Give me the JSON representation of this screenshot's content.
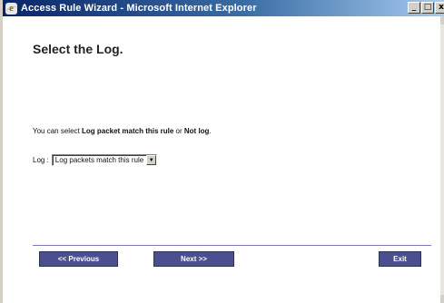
{
  "window": {
    "title": "Access Rule Wizard - Microsoft Internet Explorer",
    "minimize_glyph": "_",
    "maximize_glyph": "□",
    "close_glyph": "x"
  },
  "page": {
    "heading": "Select the Log.",
    "info_prefix": "You can select ",
    "info_option1": "Log packet match this rule",
    "info_or": " or ",
    "info_option2": "Not log",
    "info_suffix": ".",
    "log_label": "Log :",
    "log_selected": "Log packets match this rule",
    "dropdown_arrow": "▼"
  },
  "buttons": {
    "previous": "<< Previous",
    "next": "Next >>",
    "exit": "Exit"
  }
}
